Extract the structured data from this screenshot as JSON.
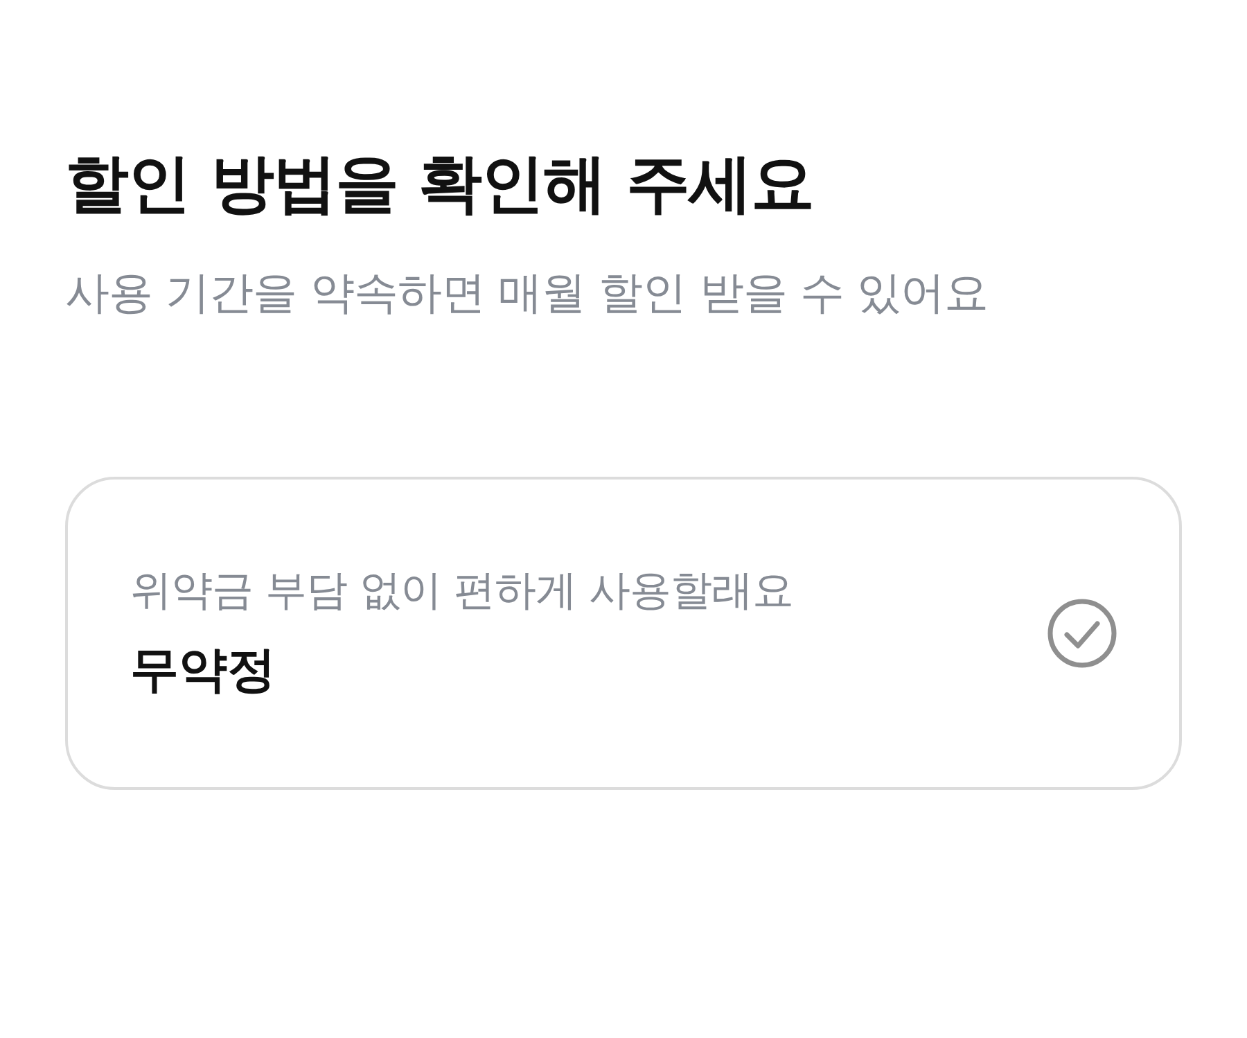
{
  "title": "할인 방법을 확인해 주세요",
  "subtitle": "사용 기간을 약속하면 매월 할인 받을 수 있어요",
  "options": [
    {
      "description": "위약금 부담 없이 편하게 사용할래요",
      "label": "무약정",
      "selected": false
    }
  ]
}
